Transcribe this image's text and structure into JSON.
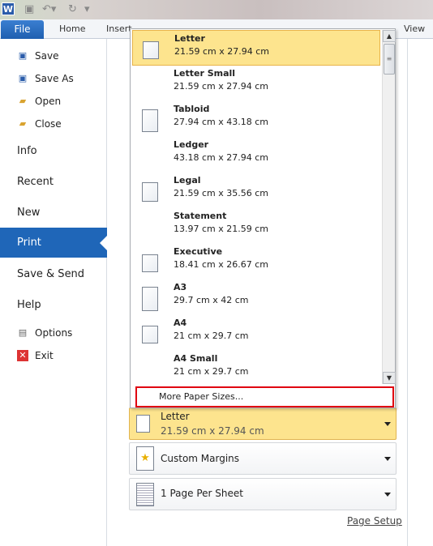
{
  "ribbon": {
    "file": "File",
    "tabs": [
      "Home",
      "Insert",
      "View"
    ]
  },
  "sidebar": {
    "items": [
      {
        "label": "Save",
        "icon": "save-icon"
      },
      {
        "label": "Save As",
        "icon": "save-as-icon"
      },
      {
        "label": "Open",
        "icon": "open-folder-icon"
      },
      {
        "label": "Close",
        "icon": "close-folder-icon"
      },
      {
        "label": "Info"
      },
      {
        "label": "Recent"
      },
      {
        "label": "New"
      },
      {
        "label": "Print",
        "selected": true
      },
      {
        "label": "Save & Send"
      },
      {
        "label": "Help"
      },
      {
        "label": "Options",
        "icon": "options-icon"
      },
      {
        "label": "Exit",
        "icon": "exit-icon"
      }
    ]
  },
  "paper_sizes": [
    {
      "name": "Letter",
      "dims": "21.59 cm x 27.94 cm",
      "selected": true
    },
    {
      "name": "Letter Small",
      "dims": "21.59 cm x 27.94 cm"
    },
    {
      "name": "Tabloid",
      "dims": "27.94 cm x 43.18 cm"
    },
    {
      "name": "Ledger",
      "dims": "43.18 cm x 27.94 cm"
    },
    {
      "name": "Legal",
      "dims": "21.59 cm x 35.56 cm"
    },
    {
      "name": "Statement",
      "dims": "13.97 cm x 21.59 cm"
    },
    {
      "name": "Executive",
      "dims": "18.41 cm x 26.67 cm"
    },
    {
      "name": "A3",
      "dims": "29.7 cm x 42 cm"
    },
    {
      "name": "A4",
      "dims": "21 cm x 29.7 cm"
    },
    {
      "name": "A4 Small",
      "dims": "21 cm x 29.7 cm"
    }
  ],
  "more_paper_sizes": "More Paper Sizes...",
  "settings": {
    "paper": {
      "name": "Letter",
      "dims": "21.59 cm x 27.94 cm"
    },
    "margins": "Custom Margins",
    "pages_per_sheet": "1 Page Per Sheet",
    "page_setup": "Page Setup"
  },
  "colors": {
    "accent": "#1f66b8",
    "highlight": "#fde48e",
    "outline": "#e00010"
  }
}
